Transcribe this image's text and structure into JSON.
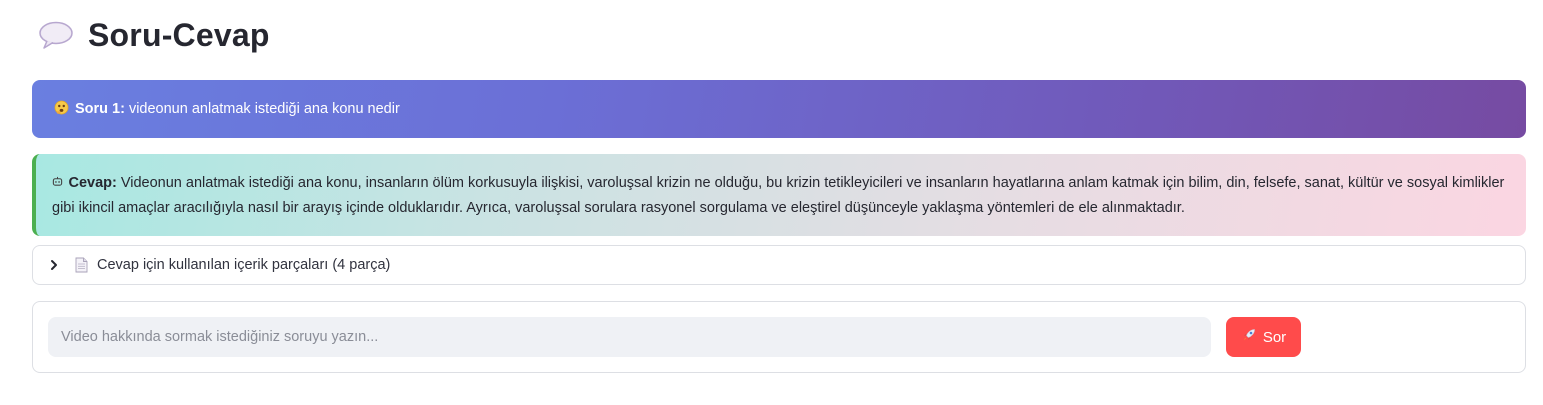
{
  "header": {
    "icon": "speech-balloon-icon",
    "title": "Soru-Cevap"
  },
  "question": {
    "icon": "thinking-face-icon",
    "label": "Soru 1:",
    "text": "videonun anlatmak istediği ana konu nedir",
    "colors": {
      "gradient_start": "#667eea",
      "gradient_end": "#764ba2"
    }
  },
  "answer": {
    "icon": "robot-icon",
    "label": "Cevap:",
    "text": "Videonun anlatmak istediği ana konu, insanların ölüm korkusuyla ilişkisi, varoluşsal krizin ne olduğu, bu krizin tetikleyicileri ve insanların hayatlarına anlam katmak için bilim, din, felsefe, sanat, kültür ve sosyal kimlikler gibi ikincil amaçlar aracılığıyla nasıl bir arayış içinde olduklarıdır. Ayrıca, varoluşsal sorulara rasyonel sorgulama ve eleştirel düşünceyle yaklaşma yöntemleri de ele alınmaktadır.",
    "colors": {
      "border": "#4caf50",
      "gradient_start": "#a8edea",
      "gradient_end": "#fed6e3"
    }
  },
  "sources_expander": {
    "chevron_icon": "chevron-right-icon",
    "icon": "page-icon",
    "label": "Cevap için kullanılan içerik parçaları (4 parça)"
  },
  "ask_form": {
    "input_value": "",
    "input_placeholder": "Video hakkında sormak istediğiniz soruyu yazın...",
    "button_icon": "rocket-icon",
    "button_label": "Sor",
    "colors": {
      "button": "#ff4b4b",
      "input_bg": "#eff1f5"
    }
  }
}
